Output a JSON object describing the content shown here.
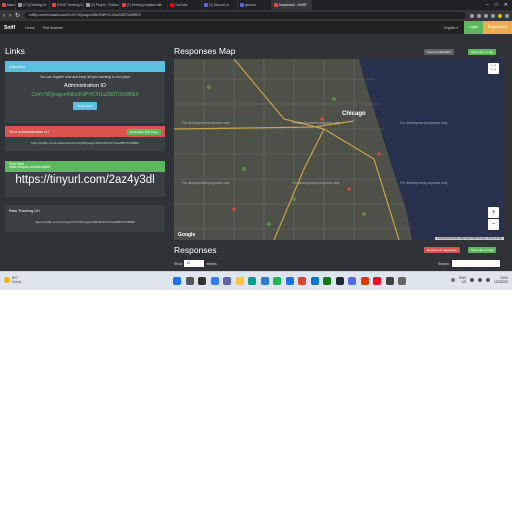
{
  "browser": {
    "tabs": [
      {
        "label": "Menu",
        "color": "#e8453c"
      },
      {
        "label": "(17) [Drinking Gr",
        "color": "#9aa0a6"
      },
      {
        "label": "EXPAT Drinking Gr",
        "color": "#e8453c"
      },
      {
        "label": "(2) People · Roblox",
        "color": "#9aa0a6"
      },
      {
        "label": "(1) Drinking empties with",
        "color": "#e8453c"
      },
      {
        "label": "YouTube",
        "color": "#ff0000"
      },
      {
        "label": "(1) Discord | #",
        "color": "#5865f2"
      },
      {
        "label": "general",
        "color": "#5865f2"
      },
      {
        "label": "Dashboard - SniffIP",
        "color": "#e8453c"
      }
    ],
    "active_tab_index": 8,
    "url": "sniffip.com/en/dashboard/CxhV78Qeagzr4N6n9NiPHCXt1aZB8T3UWBE8",
    "controls": [
      "–",
      "□",
      "✕"
    ]
  },
  "site": {
    "brand": "Sniff",
    "nav": [
      "Home",
      "Port scanner"
    ],
    "language": "English ▾",
    "login": "Login",
    "register": "Registration"
  },
  "links": {
    "title": "Links",
    "attention": {
      "header": "Attention",
      "text": "You can register now and keep all your tracking in one place",
      "admin_id_label": "Administration ID",
      "admin_id": "CxhV78Qeagzr4N6n9NiPHCXt1aZB8T3UWBE8",
      "button": "Registration"
    },
    "admin_url": {
      "header": "Your administration url",
      "button": "Bookmark This Page",
      "url": "https://sniffip.com/en/dashboard/CxhV78Qeagzr4N6n9NiPHCXt1aZB8T3UWBE8"
    },
    "short_link": {
      "header": "Short link",
      "header_overlay": "https://tinyurl.com/2az4y3dl",
      "link": "https://tinyurl.com/2az4y3dl"
    },
    "raw_url": {
      "header": "Raw Tracking Url",
      "url": "https://sniffip.com/tracking/CxhV78Qeagzr4N6n9NiPHCXt1aZB8T3UWBE8"
    }
  },
  "map": {
    "title": "Responses Map",
    "sound_button": "Sound notification",
    "show_all_button": "Show all on map",
    "watermark": "For development purposes only",
    "city": "Chicago",
    "google": "Google",
    "attribution": "Keyboard shortcuts | Map data ©2022 Google | Terms of Use",
    "zoom_in": "+",
    "zoom_out": "−",
    "fullscreen": "⛶",
    "land_color": "#4e5147",
    "water_color": "#27314d"
  },
  "responses": {
    "title": "Responses",
    "remove_all": "Remove all responses",
    "show_all": "Show all on map",
    "show_label": "Show",
    "entries_value": "10",
    "entries_label": "entries",
    "search_label": "Search:"
  },
  "taskbar": {
    "temp": "8°C",
    "weather": "Mostly",
    "lang": "ENG",
    "region": "US",
    "time": "13:51",
    "date": "11/3/2022",
    "apps": [
      {
        "name": "start-icon",
        "color": "#1a73e8"
      },
      {
        "name": "search-icon",
        "color": "#555555"
      },
      {
        "name": "task-view-icon",
        "color": "#333333"
      },
      {
        "name": "widgets-icon",
        "color": "#2d7ff9"
      },
      {
        "name": "chat-icon",
        "color": "#6264a7"
      },
      {
        "name": "file-explorer-icon",
        "color": "#f4c542"
      },
      {
        "name": "edge-icon",
        "color": "#0f9d8a"
      },
      {
        "name": "store-icon",
        "color": "#2b7cd3"
      },
      {
        "name": "spotify-icon",
        "color": "#1db954"
      },
      {
        "name": "mail-icon",
        "color": "#1a73e8"
      },
      {
        "name": "chrome-icon",
        "color": "#db4437"
      },
      {
        "name": "photos-icon",
        "color": "#0078d4"
      },
      {
        "name": "xbox-icon",
        "color": "#107c10"
      },
      {
        "name": "steam-icon",
        "color": "#1b2838"
      },
      {
        "name": "discord-icon",
        "color": "#5865f2"
      },
      {
        "name": "office-icon",
        "color": "#d83b01"
      },
      {
        "name": "opera-icon",
        "color": "#e81123"
      },
      {
        "name": "calculator-icon",
        "color": "#404040"
      },
      {
        "name": "settings-icon",
        "color": "#666666"
      }
    ]
  }
}
